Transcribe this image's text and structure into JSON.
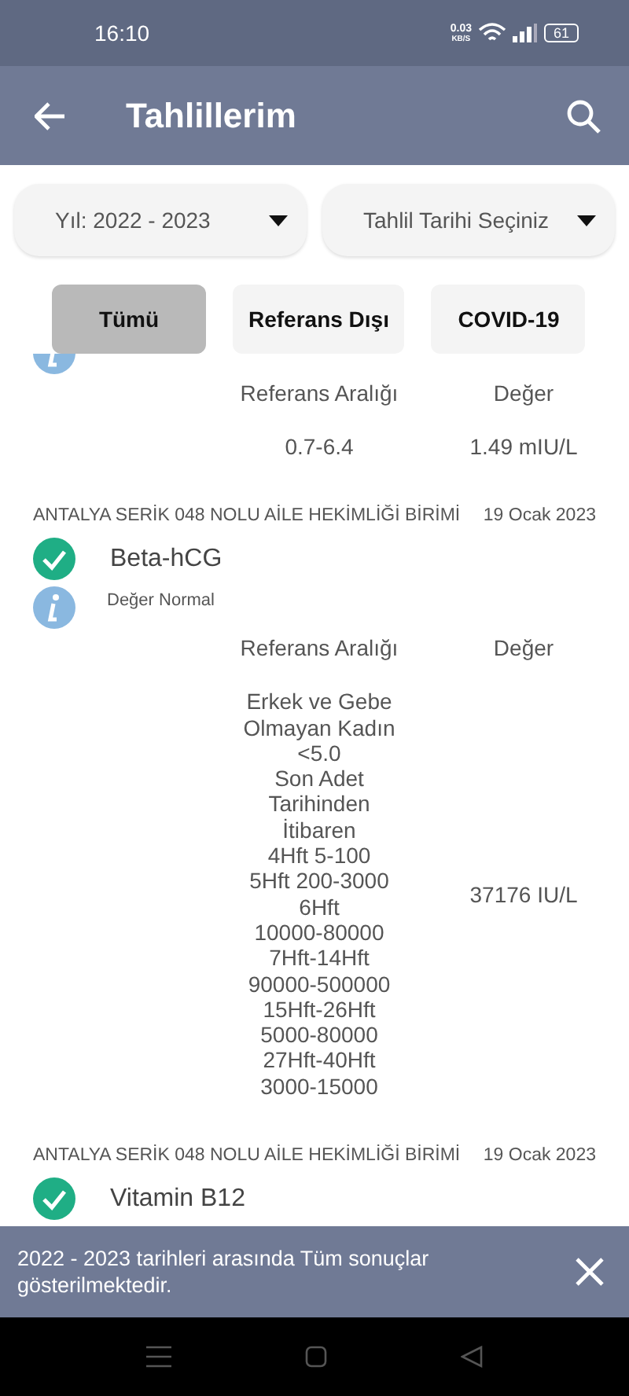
{
  "status_bar": {
    "time": "16:10",
    "speed": "0.03",
    "speed_unit": "KB/S",
    "battery": "61"
  },
  "app_bar": {
    "title": "Tahlillerim"
  },
  "filters": [
    {
      "label": "Yıl: 2022 - 2023"
    },
    {
      "label": "Tahlil Tarihi Seçiniz"
    }
  ],
  "chips": [
    {
      "label": "Tümü",
      "selected": true
    },
    {
      "label": "Referans Dışı",
      "selected": false
    },
    {
      "label": "COVID-19",
      "selected": false
    }
  ],
  "results": [
    {
      "cut_top": true,
      "info": true,
      "reference_header": "Referans Aralığı",
      "value_header": "Değer",
      "reference": "0.7-6.4",
      "value": "1.49 mIU/L"
    },
    {
      "lab": "ANTALYA SERİK 048 NOLU AİLE HEKİMLİĞİ BİRİMİ",
      "date": "19 Ocak 2023",
      "test": "Beta-hCG",
      "normal": true,
      "info": true,
      "status_text": "Değer Normal",
      "reference_header": "Referans Aralığı",
      "value_header": "Değer",
      "reference": "Erkek ve Gebe\nOlmayan Kadın\n<5.0\nSon Adet\nTarihinden\nİtibaren\n4Hft 5-100\n5Hft 200-3000\n6Hft\n10000-80000\n7Hft-14Hft\n90000-500000\n15Hft-26Hft\n5000-80000\n27Hft-40Hft\n3000-15000",
      "value": "37176 IU/L"
    },
    {
      "lab": "ANTALYA SERİK 048 NOLU AİLE HEKİMLİĞİ BİRİMİ",
      "date": "19 Ocak 2023",
      "test": "Vitamin B12",
      "normal": true
    }
  ],
  "snackbar": {
    "message": "2022 - 2023 tarihleri arasında Tüm sonuçlar gösterilmektedir."
  }
}
